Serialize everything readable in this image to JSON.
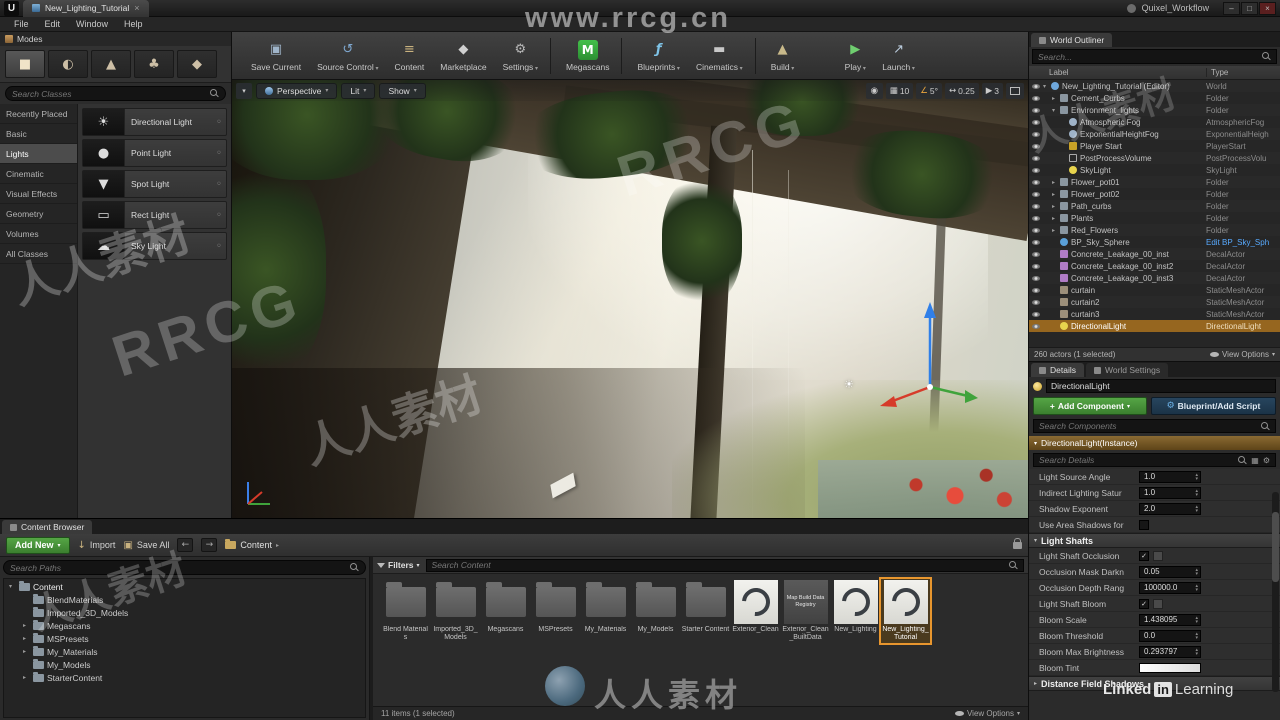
{
  "icons": {
    "unreal_logo": "U",
    "megascans_m": "M"
  },
  "title_bar": {
    "tab_title": "New_Lighting_Tutorial",
    "workspace": "Quixel_Workflow"
  },
  "menu_bar": {
    "items": [
      {
        "label": "File"
      },
      {
        "label": "Edit"
      },
      {
        "label": "Window"
      },
      {
        "label": "Help"
      }
    ]
  },
  "modes_panel": {
    "title": "Modes",
    "search_placeholder": "Search Classes",
    "categories": [
      {
        "label": "Recently Placed"
      },
      {
        "label": "Basic"
      },
      {
        "label": "Lights",
        "cls": "selected"
      },
      {
        "label": "Cinematic"
      },
      {
        "label": "Visual Effects"
      },
      {
        "label": "Geometry"
      },
      {
        "label": "Volumes"
      },
      {
        "label": "All Classes"
      }
    ],
    "lights": [
      {
        "label": "Directional Light",
        "glyph": "☀"
      },
      {
        "label": "Point Light",
        "glyph": "●"
      },
      {
        "label": "Spot Light",
        "glyph": "▼"
      },
      {
        "label": "Rect Light",
        "glyph": "▭"
      },
      {
        "label": "Sky Light",
        "glyph": "☁"
      }
    ]
  },
  "main_toolbar": {
    "buttons": [
      {
        "label": "Save Current",
        "glyph": "▣",
        "cls": "ic-save"
      },
      {
        "label": "Source Control",
        "glyph": "↺",
        "cls": "ic-source has-arrow"
      },
      {
        "label": "Content",
        "glyph": "≡",
        "cls": "ic-content"
      },
      {
        "label": "Marketplace",
        "glyph": "◆",
        "cls": "ic-marketplace"
      },
      {
        "label": "Settings",
        "glyph": "⚙",
        "cls": "ic-settings has-arrow sep-after"
      },
      {
        "label": "Megascans",
        "glyph": "M",
        "cls": "ic-megascans sep-after"
      },
      {
        "label": "Blueprints",
        "glyph": "ƒ",
        "cls": "ic-blueprints has-arrow"
      },
      {
        "label": "Cinematics",
        "glyph": "▬",
        "cls": "ic-cinematics has-arrow sep-after"
      },
      {
        "label": "Build",
        "glyph": "▲",
        "cls": "ic-build has-arrow"
      },
      {
        "label": "Play",
        "glyph": "▶",
        "cls": "ic-play has-arrow gap-before"
      },
      {
        "label": "Launch",
        "glyph": "↗",
        "cls": "ic-launch has-arrow"
      }
    ]
  },
  "viewport": {
    "perspective_label": "Perspective",
    "lit_label": "Lit",
    "show_label": "Show",
    "grid_snap": "10",
    "angle_snap": "5°",
    "scale_snap": "0.25",
    "camera_speed": "3"
  },
  "outliner": {
    "title": "World Outliner",
    "search_placeholder": "Search...",
    "columns": {
      "label": "Label",
      "type": "Type"
    },
    "rows": [
      {
        "label": "New_Lighting_Tutorial (Editor)",
        "type": "World",
        "cls": "ind0 exp i-world"
      },
      {
        "label": "Cement_Curbs",
        "type": "Folder",
        "cls": "ind1 col i-folder"
      },
      {
        "label": "Environment_lights",
        "type": "Folder",
        "cls": "ind1 exp i-folder"
      },
      {
        "label": "Atmospheric Fog",
        "type": "AtmosphericFog",
        "cls": "ind2 i-fog"
      },
      {
        "label": "ExponentialHeightFog",
        "type": "ExponentialHeigh",
        "cls": "ind2 i-fog"
      },
      {
        "label": "Player Start",
        "type": "PlayerStart",
        "cls": "ind2 i-player"
      },
      {
        "label": "PostProcessVolume",
        "type": "PostProcessVolu",
        "cls": "ind2 i-volume"
      },
      {
        "label": "SkyLight",
        "type": "SkyLight",
        "cls": "ind2 i-light"
      },
      {
        "label": "Flower_pot01",
        "type": "Folder",
        "cls": "ind1 col i-folder"
      },
      {
        "label": "Flower_pot02",
        "type": "Folder",
        "cls": "ind1 col i-folder"
      },
      {
        "label": "Path_curbs",
        "type": "Folder",
        "cls": "ind1 col i-folder"
      },
      {
        "label": "Plants",
        "type": "Folder",
        "cls": "ind1 col i-folder"
      },
      {
        "label": "Red_Flowers",
        "type": "Folder",
        "cls": "ind1 col i-folder"
      },
      {
        "label": "BP_Sky_Sphere",
        "type": "Edit BP_Sky_Sph",
        "cls": "ind1 i-actor bluelink"
      },
      {
        "label": "Concrete_Leakage_00_inst",
        "type": "DecalActor",
        "cls": "ind1 i-decal"
      },
      {
        "label": "Concrete_Leakage_00_inst2",
        "type": "DecalActor",
        "cls": "ind1 i-decal"
      },
      {
        "label": "Concrete_Leakage_00_inst3",
        "type": "DecalActor",
        "cls": "ind1 i-decal"
      },
      {
        "label": "curtain",
        "type": "StaticMeshActor",
        "cls": "ind1 i-mesh"
      },
      {
        "label": "curtain2",
        "type": "StaticMeshActor",
        "cls": "ind1 i-mesh"
      },
      {
        "label": "curtain3",
        "type": "StaticMeshActor",
        "cls": "ind1 i-mesh"
      },
      {
        "label": "DirectionalLight",
        "type": "DirectionalLight",
        "cls": "ind1 i-light selected"
      }
    ],
    "footer": "260 actors (1 selected)",
    "view_options": "View Options"
  },
  "details": {
    "tab_details": "Details",
    "tab_world_settings": "World Settings",
    "name_value": "DirectionalLight",
    "add_component": "Add Component",
    "add_component_plus": "+",
    "blueprint_button": "Blueprint/Add Script",
    "search_components_placeholder": "Search Components",
    "instance_row": "DirectionalLight(Instance)",
    "search_details_placeholder": "Search Details",
    "properties": [
      {
        "label": "Light Source Angle",
        "value": "1.0",
        "cls": "kind-spin"
      },
      {
        "label": "Indirect Lighting Satur",
        "value": "1.0",
        "cls": "kind-spin"
      },
      {
        "label": "Shadow Exponent",
        "value": "2.0",
        "cls": "kind-spin"
      },
      {
        "label": "Use Area Shadows for",
        "cls": "kind-check"
      }
    ],
    "light_shafts": {
      "title": "Light Shafts",
      "properties": [
        {
          "label": "Light Shaft Occlusion",
          "cls": "kind-check checked aux-on"
        },
        {
          "label": "Occlusion Mask Darkn",
          "value": "0.05",
          "cls": "kind-spin"
        },
        {
          "label": "Occlusion Depth Rang",
          "value": "100000.0",
          "cls": "kind-spin"
        },
        {
          "label": "Light Shaft Bloom",
          "cls": "kind-check checked aux-on"
        },
        {
          "label": "Bloom Scale",
          "value": "1.438095",
          "cls": "kind-spin"
        },
        {
          "label": "Bloom Threshold",
          "value": "0.0",
          "cls": "kind-spin"
        },
        {
          "label": "Bloom Max Brightness",
          "value": "0.293797",
          "cls": "kind-spin"
        },
        {
          "label": "Bloom Tint",
          "cls": "kind-color"
        }
      ]
    },
    "distance_field": "Distance Field Shadows"
  },
  "content_browser": {
    "tab_title": "Content Browser",
    "add_new": "Add New",
    "import_label": "Import",
    "save_all": "Save All",
    "breadcrumb": "Content",
    "search_paths_placeholder": "Search Paths",
    "tree": [
      {
        "label": "Content",
        "cls": "root open"
      },
      {
        "label": "BlendMaterials",
        "cls": "child"
      },
      {
        "label": "Imported_3D_Models",
        "cls": "child"
      },
      {
        "label": "Megascans",
        "cls": "child exp"
      },
      {
        "label": "MSPresets",
        "cls": "child exp"
      },
      {
        "label": "My_Materials",
        "cls": "child exp"
      },
      {
        "label": "My_Models",
        "cls": "child"
      },
      {
        "label": "StarterContent",
        "cls": "child exp"
      }
    ],
    "filters_label": "Filters",
    "search_content_placeholder": "Search Content",
    "assets": [
      {
        "label": "Blend Materials",
        "cls": "folder"
      },
      {
        "label": "Imported_3D_Models",
        "cls": "folder"
      },
      {
        "label": "Megascans",
        "cls": "folder"
      },
      {
        "label": "MSPresets",
        "cls": "folder"
      },
      {
        "label": "My_Materials",
        "cls": "folder"
      },
      {
        "label": "My_Models",
        "cls": "folder"
      },
      {
        "label": "Starter Content",
        "cls": "folder"
      },
      {
        "label": "Exterior_Clean",
        "cls": "level"
      },
      {
        "label": "Exterior_Clean_BuiltData",
        "badge": "Map Build Data Registry",
        "cls": "builddata"
      },
      {
        "label": "New_Lighting",
        "cls": "level"
      },
      {
        "label": "New_Lighting_Tutorial",
        "cls": "level selected"
      }
    ],
    "footer": "11 items (1 selected)",
    "view_options": "View Options"
  },
  "watermarks": {
    "url": "www.rrcg.cn",
    "site_cn": "人人素材",
    "site_en": "RRCG",
    "footer_logo_text": "人人素材",
    "linkedin_word1": "Linked",
    "linkedin_word2": "in",
    "linkedin_word3": "Learning"
  }
}
